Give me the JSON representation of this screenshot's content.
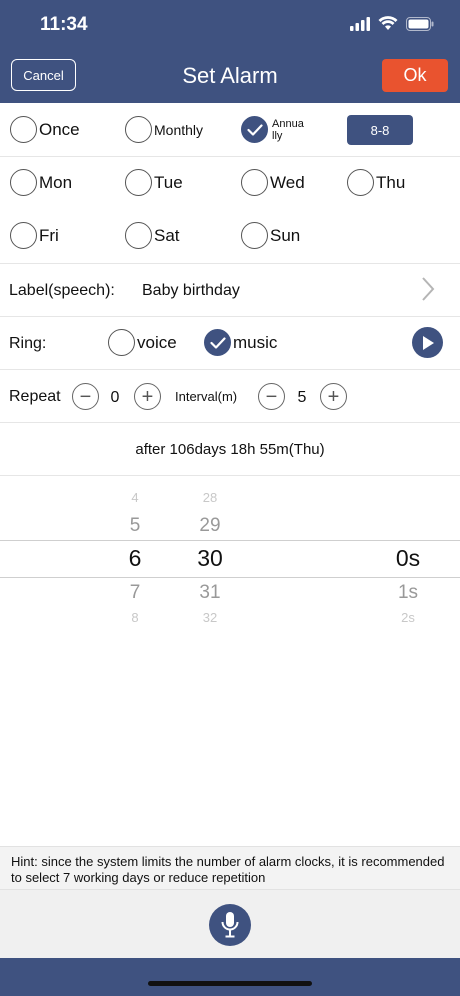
{
  "status": {
    "time": "11:34"
  },
  "header": {
    "cancel": "Cancel",
    "title": "Set Alarm",
    "ok": "Ok"
  },
  "freq": {
    "once": "Once",
    "monthly": "Monthly",
    "annually": "Annua\nlly",
    "date_btn": "8-8"
  },
  "days": {
    "mon": "Mon",
    "tue": "Tue",
    "wed": "Wed",
    "thu": "Thu",
    "fri": "Fri",
    "sat": "Sat",
    "sun": "Sun"
  },
  "label_row": {
    "key": "Label(speech):",
    "value": "Baby birthday"
  },
  "ring": {
    "key": "Ring:",
    "voice": "voice",
    "music": "music"
  },
  "repeat": {
    "key": "Repeat",
    "value": "0",
    "interval_key": "Interval(m)",
    "interval_value": "5",
    "minus": "−",
    "plus": "+"
  },
  "after_text": "after 106days 18h 55m(Thu)",
  "picker": {
    "col1": [
      "4",
      "5",
      "6",
      "7",
      "8"
    ],
    "col2": [
      "28",
      "29",
      "30",
      "31",
      "32"
    ],
    "col3": [
      "0s",
      "1s",
      "2s"
    ]
  },
  "hint": "Hint: since the system limits the number of alarm clocks, it is recommended to select 7 working days or reduce repetition",
  "colors": {
    "primary": "#3f5280",
    "ok": "#e9532f"
  }
}
